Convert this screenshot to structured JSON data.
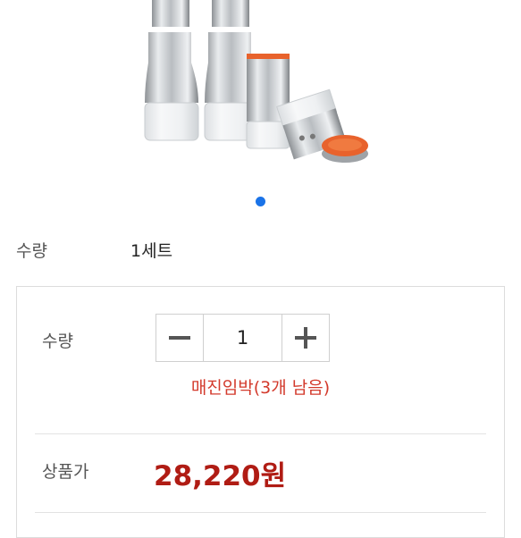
{
  "product_image": {
    "icon": "spice-bottle-set-photo"
  },
  "carousel": {
    "active_index": 0,
    "total": 1
  },
  "quantity_info": {
    "label": "수량",
    "value": "1세트"
  },
  "order_panel": {
    "quantity_label": "수량",
    "quantity_value": "1",
    "minus_icon": "minus-icon",
    "plus_icon": "plus-icon",
    "stock_notice": "매진임박(3개 남음)",
    "price_label": "상품가",
    "price": "28,220원"
  },
  "colors": {
    "accent": "#1a73e8",
    "price": "#b01c14",
    "warning": "#d33a2c"
  }
}
